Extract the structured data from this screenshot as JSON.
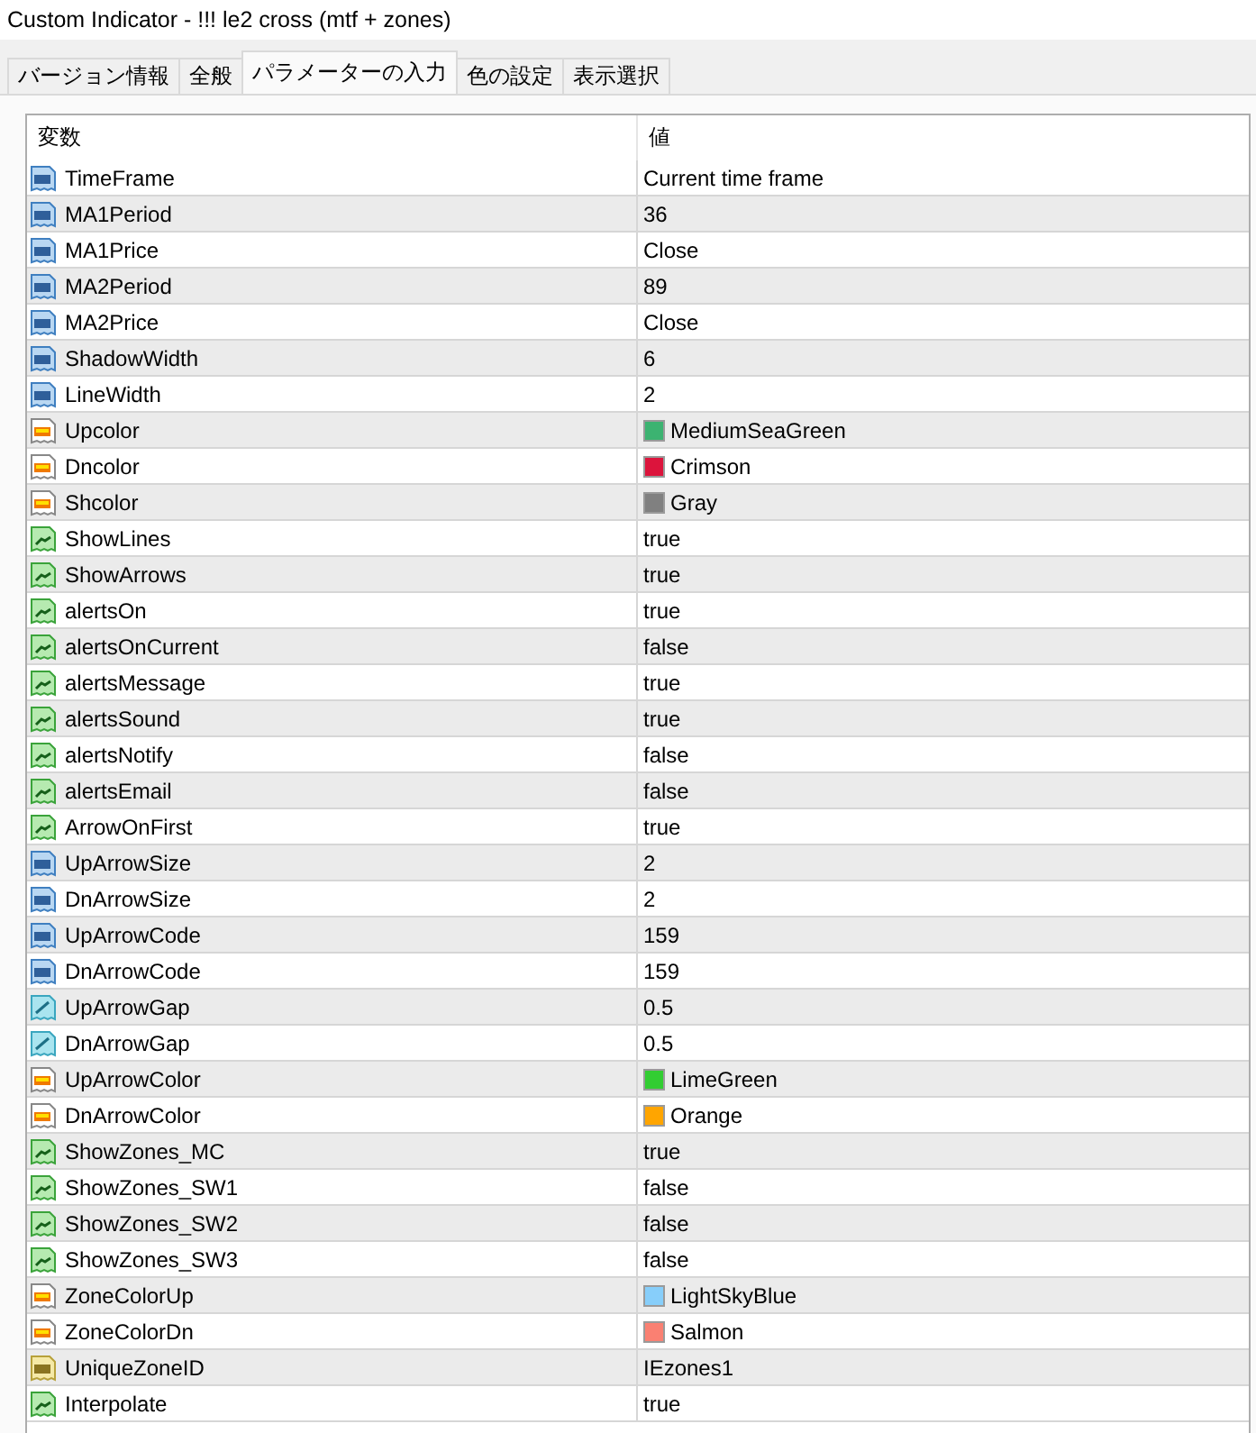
{
  "window": {
    "title": "Custom Indicator - !!! le2 cross (mtf + zones)"
  },
  "tabs": [
    {
      "label": "バージョン情報",
      "selected": false
    },
    {
      "label": "全般",
      "selected": false
    },
    {
      "label": "パラメーターの入力",
      "selected": true
    },
    {
      "label": "色の設定",
      "selected": false
    },
    {
      "label": "表示選択",
      "selected": false
    }
  ],
  "table": {
    "columns": [
      "変数",
      "値"
    ],
    "rows": [
      {
        "kind": "int",
        "name": "TimeFrame",
        "value": "Current time frame"
      },
      {
        "kind": "int",
        "name": "MA1Period",
        "value": "36"
      },
      {
        "kind": "int",
        "name": "MA1Price",
        "value": "Close"
      },
      {
        "kind": "int",
        "name": "MA2Period",
        "value": "89"
      },
      {
        "kind": "int",
        "name": "MA2Price",
        "value": "Close"
      },
      {
        "kind": "int",
        "name": "ShadowWidth",
        "value": "6"
      },
      {
        "kind": "int",
        "name": "LineWidth",
        "value": "2"
      },
      {
        "kind": "color",
        "name": "Upcolor",
        "value": "MediumSeaGreen",
        "color": "#3cb371"
      },
      {
        "kind": "color",
        "name": "Dncolor",
        "value": "Crimson",
        "color": "#dc143c"
      },
      {
        "kind": "color",
        "name": "Shcolor",
        "value": "Gray",
        "color": "#808080"
      },
      {
        "kind": "bool",
        "name": "ShowLines",
        "value": "true"
      },
      {
        "kind": "bool",
        "name": "ShowArrows",
        "value": "true"
      },
      {
        "kind": "bool",
        "name": "alertsOn",
        "value": "true"
      },
      {
        "kind": "bool",
        "name": "alertsOnCurrent",
        "value": "false"
      },
      {
        "kind": "bool",
        "name": "alertsMessage",
        "value": "true"
      },
      {
        "kind": "bool",
        "name": "alertsSound",
        "value": "true"
      },
      {
        "kind": "bool",
        "name": "alertsNotify",
        "value": "false"
      },
      {
        "kind": "bool",
        "name": "alertsEmail",
        "value": "false"
      },
      {
        "kind": "bool",
        "name": "ArrowOnFirst",
        "value": "true"
      },
      {
        "kind": "int",
        "name": "UpArrowSize",
        "value": "2"
      },
      {
        "kind": "int",
        "name": "DnArrowSize",
        "value": "2"
      },
      {
        "kind": "int",
        "name": "UpArrowCode",
        "value": "159"
      },
      {
        "kind": "int",
        "name": "DnArrowCode",
        "value": "159"
      },
      {
        "kind": "double",
        "name": "UpArrowGap",
        "value": "0.5"
      },
      {
        "kind": "double",
        "name": "DnArrowGap",
        "value": "0.5"
      },
      {
        "kind": "color",
        "name": "UpArrowColor",
        "value": "LimeGreen",
        "color": "#32cd32"
      },
      {
        "kind": "color",
        "name": "DnArrowColor",
        "value": "Orange",
        "color": "#ffa500"
      },
      {
        "kind": "bool",
        "name": "ShowZones_MC",
        "value": "true"
      },
      {
        "kind": "bool",
        "name": "ShowZones_SW1",
        "value": "false"
      },
      {
        "kind": "bool",
        "name": "ShowZones_SW2",
        "value": "false"
      },
      {
        "kind": "bool",
        "name": "ShowZones_SW3",
        "value": "false"
      },
      {
        "kind": "color",
        "name": "ZoneColorUp",
        "value": "LightSkyBlue",
        "color": "#87cefa"
      },
      {
        "kind": "color",
        "name": "ZoneColorDn",
        "value": "Salmon",
        "color": "#fa8072"
      },
      {
        "kind": "string",
        "name": "UniqueZoneID",
        "value": "IEzones1"
      },
      {
        "kind": "bool",
        "name": "Interpolate",
        "value": "true"
      }
    ]
  }
}
